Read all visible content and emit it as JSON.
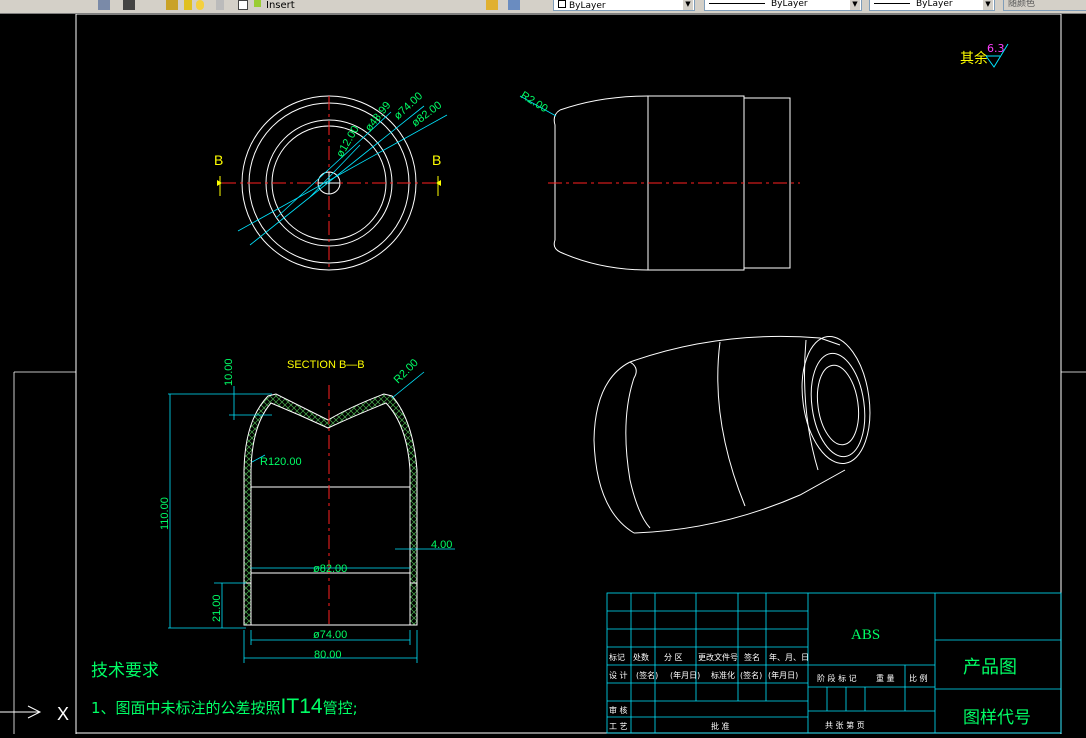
{
  "toolbar": {
    "layer_insert_label": "Insert",
    "color_combo": "ByLayer",
    "linetype_combo": "ByLayer",
    "lineweight_combo": "ByLayer",
    "plotstyle_combo": "随颜色"
  },
  "drawing": {
    "roughness_label": "其余",
    "roughness_value": "6.3",
    "section_marker_left": "B",
    "section_marker_right": "B",
    "front_view": {
      "d1": "ø12.00",
      "d2": "ø48.99",
      "d3": "ø74.00",
      "d4": "ø82.00"
    },
    "side_view": {
      "radius": "R2.00"
    },
    "section": {
      "title": "SECTION  B—B",
      "top_radius": "R2.00",
      "dim_10": "10.00",
      "dim_110": "110.00",
      "dim_21": "21.00",
      "r120": "R120.00",
      "wall_4": "4.00",
      "d82": "ø82.00",
      "d74": "ø74.00",
      "w80": "80.00"
    },
    "notes": {
      "title": "技术要求",
      "line1_prefix": "1、图面中未标注的公差按照",
      "line1_code": "IT14",
      "line1_suffix": "管控;"
    },
    "title_block": {
      "material": "ABS",
      "product_drawing": "产品图",
      "drawing_number": "图样代号",
      "rev_headers": [
        "标记",
        "处数",
        "分 区",
        "更改文件号",
        "签名",
        "年、月、日"
      ],
      "design_row": [
        "设 计",
        "(签名)",
        "(年月日)",
        "标准化",
        "(签名)",
        "(年月日)"
      ],
      "review": "审 核",
      "process": "工 艺",
      "approve": "批 准",
      "stage_header": "阶 段 标 记",
      "weight": "重 量",
      "scale": "比 例",
      "sheets": "共   张   第   页"
    }
  }
}
